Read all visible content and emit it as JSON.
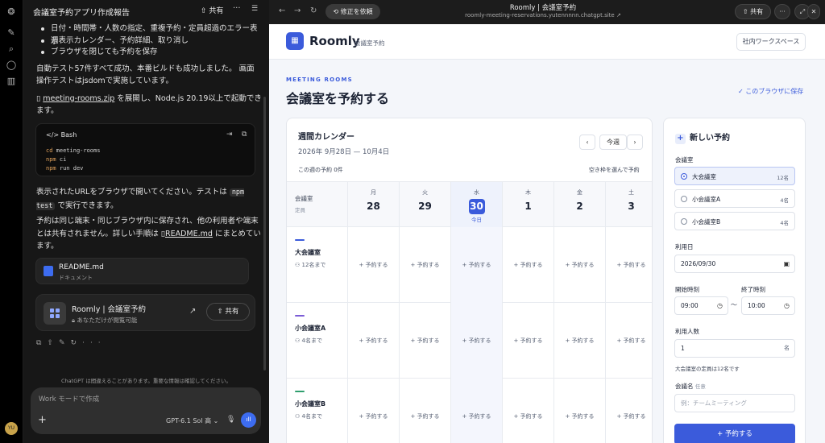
{
  "chat": {
    "title": "会議室予約アプリ作成報告",
    "share": "共有",
    "bullets": [
      "日付・時間帯・人数の指定、重複予約・定員超過のエラー表示",
      "週表示カレンダー、予約詳細、取り消し",
      "ブラウザを閉じても予約を保存"
    ],
    "para1": "自動テスト57件すべて成功、本番ビルドも成功しました。 画面操作テストはjsdomで実施しています。",
    "zip_link": "meeting-rooms.zip",
    "zip_text": " を展開し、Node.js 20.19以上で起動できます。",
    "code": {
      "lang": "Bash",
      "lines": [
        [
          "cd",
          " meeting-rooms"
        ],
        [
          "npm",
          " ci"
        ],
        [
          "npm",
          " run dev"
        ]
      ]
    },
    "para2a": "表示されたURLをブラウザで開いてください。テストは ",
    "para2code": "npm test",
    "para2b": " で実行できます。",
    "para3a": "予約は同じ端末・同じブラウザ内に保存され、他の利用者や端末とは共有されません。詳しい手順は ",
    "para3link": "README.md",
    "para3b": " にまとめています。",
    "file": {
      "name": "README.md",
      "type": "ドキュメント"
    },
    "app": {
      "name": "Roomly | 会議室予約",
      "privacy": "あなただけが閲覧可能",
      "share": "共有"
    },
    "disclaimer": "ChatGPT は間違えることがあります。重要な情報は確認してください。",
    "composer": {
      "placeholder": "Work モードで作成",
      "model": "GPT-6.1 Sol 高"
    }
  },
  "browser": {
    "fix": "修正を依頼",
    "title": "Roomly | 会議室予約",
    "url": "roomly-meeting-reservations.yutennnnn.chatgpt.site",
    "share": "共有"
  },
  "app": {
    "brand": "Roomly",
    "brand_sub": "会議室予約",
    "workspace": "社内ワークスペース",
    "eyebrow": "MEETING ROOMS",
    "heading": "会議室を予約する",
    "saved": "このブラウザに保存",
    "calendar": {
      "title": "週間カレンダー",
      "range": "2026年 9月28日 — 10月4日",
      "today_btn": "今週",
      "count": "この週の予約 0件",
      "hint": "空き枠を選んで予約",
      "room_header": "会議室",
      "room_sub": "定員",
      "today_label": "今日",
      "days": [
        {
          "name": "月",
          "date": "28"
        },
        {
          "name": "火",
          "date": "29"
        },
        {
          "name": "水",
          "date": "30"
        },
        {
          "name": "木",
          "date": "1"
        },
        {
          "name": "金",
          "date": "2"
        },
        {
          "name": "土",
          "date": "3"
        }
      ],
      "slot": "+ 予約する",
      "rooms": [
        {
          "name": "大会議室",
          "cap": "12名まで",
          "color": "#3b5bdb"
        },
        {
          "name": "小会議室A",
          "cap": "4名まで",
          "color": "#7b5cd6"
        },
        {
          "name": "小会議室B",
          "cap": "4名まで",
          "color": "#2f9e6e"
        }
      ]
    },
    "form": {
      "title": "新しい予約",
      "room_label": "会議室",
      "rooms": [
        {
          "name": "大会議室",
          "cap": "12名"
        },
        {
          "name": "小会議室A",
          "cap": "4名"
        },
        {
          "name": "小会議室B",
          "cap": "4名"
        }
      ],
      "date_label": "利用日",
      "date": "2026/09/30",
      "start_label": "開始時刻",
      "end_label": "終了時刻",
      "start": "09:00",
      "end": "10:00",
      "tilde": "〜",
      "people_label": "利用人数",
      "people": "1",
      "people_unit": "名",
      "people_hint": "大会議室の定員は12名です",
      "meeting_label": "会議名",
      "meeting_optional": "任意",
      "meeting_placeholder": "例：チームミーティング",
      "submit": "+ 予約する"
    }
  }
}
